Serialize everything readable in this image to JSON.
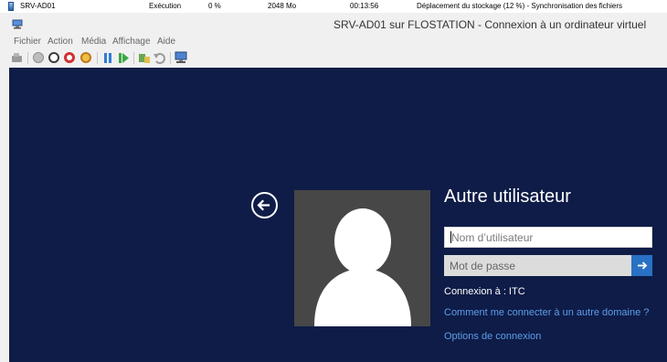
{
  "vm_row": {
    "name": "SRV-AD01",
    "state": "Exécution",
    "cpu": "0 %",
    "memory": "2048 Mo",
    "uptime": "00:13:56",
    "status": "Déplacement du stockage (12 %) - Synchronisation des fichiers"
  },
  "window": {
    "title": "SRV-AD01 sur FLOSTATION - Connexion à un ordinateur virtuel"
  },
  "menu": [
    "Fichier",
    "Action",
    "Média",
    "Affichage",
    "Aide"
  ],
  "toolbar_icons": [
    "ctrl-alt-del-icon",
    "start-icon",
    "turn-off-icon",
    "shutdown-icon",
    "save-icon",
    "pause-icon",
    "reset-icon",
    "checkpoint-icon",
    "revert-icon",
    "enhanced-session-icon"
  ],
  "login": {
    "heading": "Autre utilisateur",
    "username_placeholder": "Nom d’utilisateur",
    "password_placeholder": "Mot de passe",
    "domain_text": "Connexion à : ITC",
    "other_domain_link": "Comment me connecter à un autre domaine ?",
    "options_link": "Options de connexion"
  },
  "colors": {
    "screen_bg": "#0e1c47",
    "avatar_bg": "#474747",
    "submit_bg": "#2871c4",
    "link": "#5d9ee9"
  }
}
